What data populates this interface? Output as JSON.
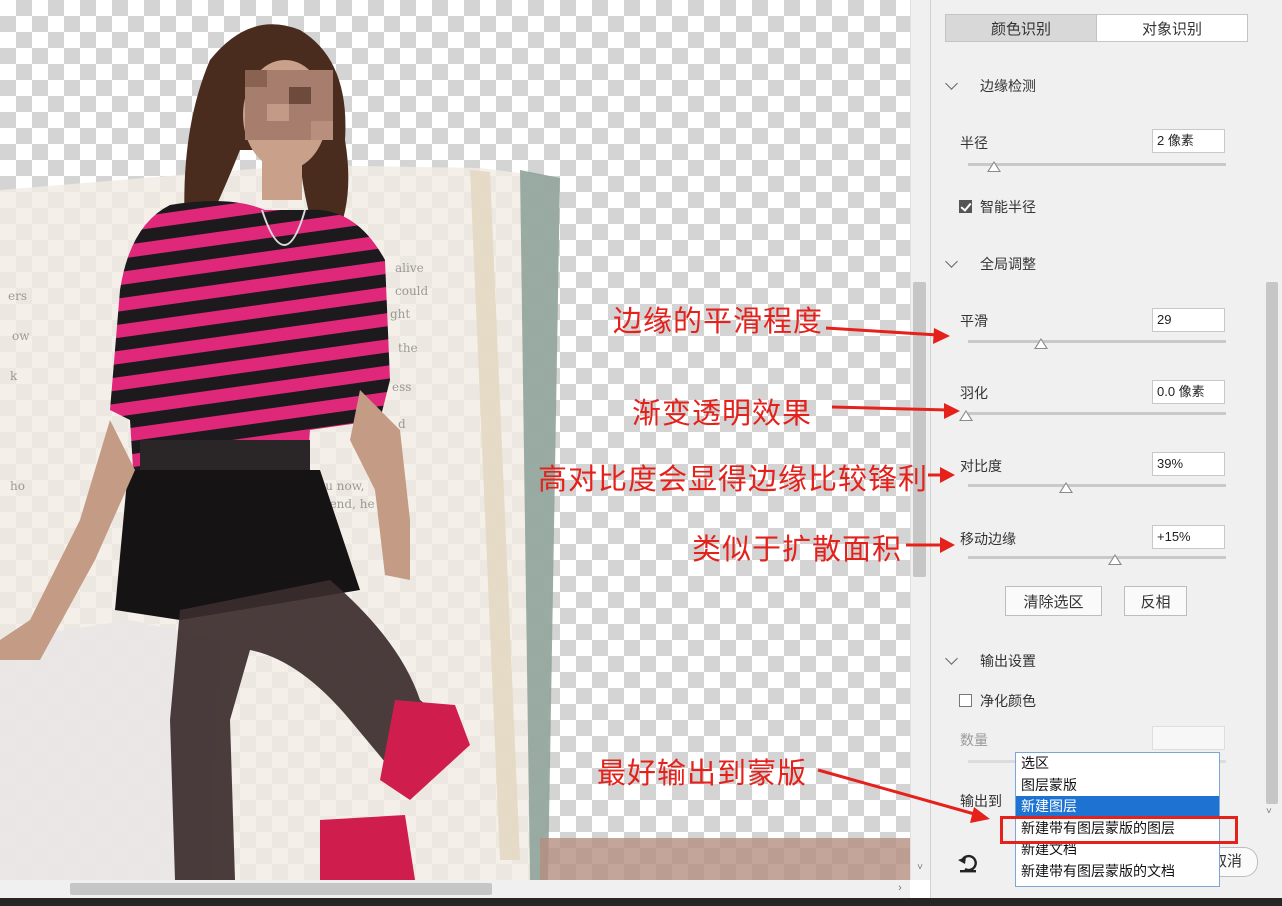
{
  "panel": {
    "tabs": [
      {
        "label": "颜色识别",
        "active": true
      },
      {
        "label": "对象识别",
        "active": false
      }
    ],
    "edge_detection": {
      "title": "边缘检测",
      "radius_label": "半径",
      "radius_value": "2 像素",
      "radius_slider": 0.1,
      "smart_radius_label": "智能半径",
      "smart_radius_checked": true
    },
    "global_adjust": {
      "title": "全局调整",
      "smooth_label": "平滑",
      "smooth_value": "29",
      "smooth_slider": 0.29,
      "feather_label": "羽化",
      "feather_value": "0.0 像素",
      "feather_slider": 0.0,
      "contrast_label": "对比度",
      "contrast_value": "39%",
      "contrast_slider": 0.39,
      "shift_edge_label": "移动边缘",
      "shift_edge_value": "+15%",
      "shift_edge_slider": 0.575,
      "clear_selection_label": "清除选区",
      "invert_label": "反相"
    },
    "output": {
      "title": "输出设置",
      "decontaminate_label": "净化颜色",
      "decontaminate_checked": false,
      "amount_label": "数量",
      "output_to_label": "输出到",
      "options": [
        "选区",
        "图层蒙版",
        "新建图层",
        "新建带有图层蒙版的图层",
        "新建文档",
        "新建带有图层蒙版的文档"
      ],
      "selected_option": "新建图层",
      "cancel_partial": "取消"
    }
  },
  "annotations": {
    "smooth": "边缘的平滑程度",
    "feather": "渐变透明效果",
    "contrast": "高对比度会显得边缘比较锋利",
    "shift_edge": "类似于扩散面积",
    "output": "最好输出到蒙版"
  },
  "colors": {
    "annotation_red": "#e5211c",
    "dropdown_selected": "#1e73d2",
    "panel_bg": "#f0f0f0"
  }
}
